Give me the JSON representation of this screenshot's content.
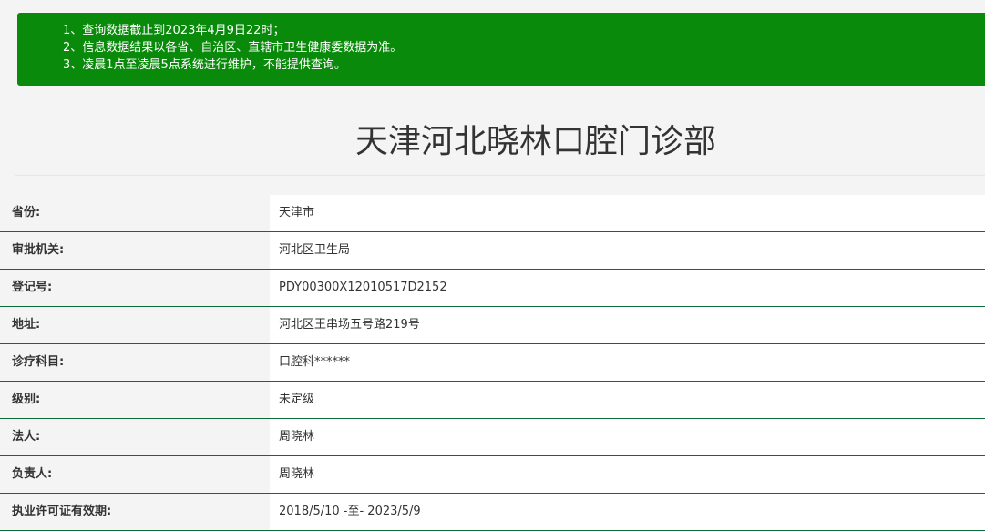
{
  "notice": {
    "lines": [
      "1、查询数据截止到2023年4月9日22时；",
      "2、信息数据结果以各省、自治区、直辖市卫生健康委数据为准。",
      "3、凌晨1点至凌晨5点系统进行维护，不能提供查询。"
    ]
  },
  "page_title": "天津河北晓林口腔门诊部",
  "info_rows": [
    {
      "label": "省份:",
      "value": "天津市"
    },
    {
      "label": "审批机关:",
      "value": "河北区卫生局"
    },
    {
      "label": "登记号:",
      "value": "PDY00300X12010517D2152"
    },
    {
      "label": "地址:",
      "value": "河北区王串场五号路219号"
    },
    {
      "label": "诊疗科目:",
      "value": "口腔科******"
    },
    {
      "label": "级别:",
      "value": "未定级"
    },
    {
      "label": "法人:",
      "value": "周晓林"
    },
    {
      "label": "负责人:",
      "value": "周晓林"
    },
    {
      "label": "执业许可证有效期:",
      "value": "2018/5/10 -至- 2023/5/9"
    }
  ],
  "colors": {
    "notice_bg": "#0a8a0a",
    "row_divider": "#0d6b3a"
  }
}
